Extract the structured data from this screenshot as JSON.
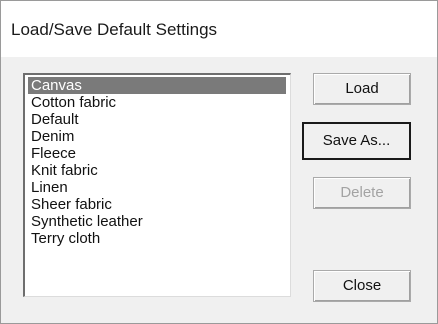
{
  "window": {
    "title": "Load/Save Default Settings"
  },
  "list": {
    "selected_index": 0,
    "items": [
      "Canvas",
      "Cotton fabric",
      "Default",
      "Denim",
      "Fleece",
      "Knit fabric",
      "Linen",
      "Sheer fabric",
      "Synthetic leather",
      "Terry cloth"
    ]
  },
  "buttons": {
    "load": {
      "label": "Load",
      "enabled": true
    },
    "save_as": {
      "label": "Save As...",
      "enabled": true,
      "focused": true
    },
    "delete": {
      "label": "Delete",
      "enabled": false
    },
    "close": {
      "label": "Close",
      "enabled": true
    }
  }
}
